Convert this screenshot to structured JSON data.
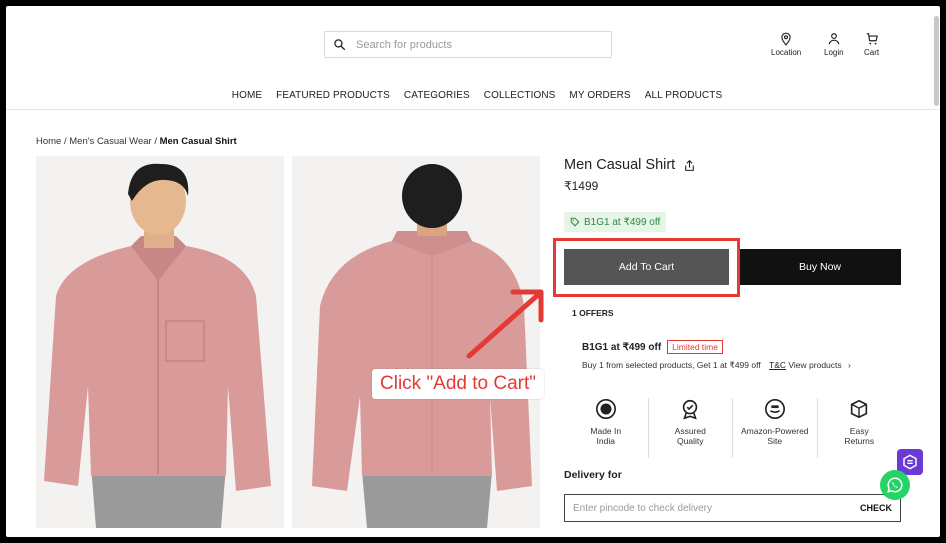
{
  "header": {
    "search_placeholder": "Search for products",
    "icons": [
      {
        "name": "location-icon",
        "label": "Location"
      },
      {
        "name": "user-icon",
        "label": "Login"
      },
      {
        "name": "cart-icon",
        "label": "Cart"
      }
    ]
  },
  "nav": [
    "HOME",
    "FEATURED PRODUCTS",
    "CATEGORIES",
    "COLLECTIONS",
    "MY ORDERS",
    "ALL PRODUCTS"
  ],
  "breadcrumb": {
    "home": "Home",
    "category": "Men's Casual Wear",
    "current": "Men Casual Shirt",
    "separator": " / "
  },
  "product": {
    "title": "Men Casual Shirt",
    "price": "₹1499",
    "offer_tag": "B1G1 at ₹499 off",
    "add_to_cart": "Add To Cart",
    "buy_now": "Buy Now",
    "offers_count": "1 OFFERS",
    "offer": {
      "name": "B1G1 at ₹499 off",
      "badge": "Limited time",
      "desc": "Buy 1 from selected products, Get 1 at ₹499 off",
      "tc": "T&C",
      "view": "View products"
    },
    "features": [
      {
        "icon": "made-in-india-icon",
        "line1": "Made In",
        "line2": "India"
      },
      {
        "icon": "assured-quality-icon",
        "line1": "Assured",
        "line2": "Quality"
      },
      {
        "icon": "amazon-powered-icon",
        "line1": "Amazon-Powered",
        "line2": "Site"
      },
      {
        "icon": "easy-returns-icon",
        "line1": "Easy",
        "line2": "Returns"
      }
    ],
    "delivery_label": "Delivery for",
    "pincode_placeholder": "Enter pincode to check delivery",
    "check": "CHECK"
  },
  "annotation": {
    "text": "Click \"Add to Cart\"",
    "color": "#e53935"
  },
  "colors": {
    "accent": "#e53935",
    "shirt": "#d99a9a",
    "buy_now": "#111111",
    "add_to_cart": "#555555"
  }
}
